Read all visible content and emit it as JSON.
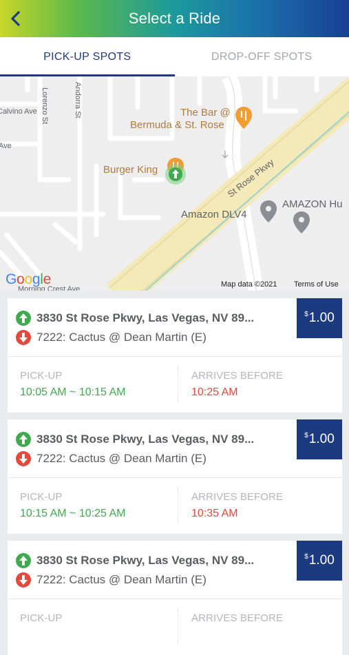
{
  "header": {
    "title": "Select a Ride",
    "back_icon": "chevron-left-icon"
  },
  "tabs": [
    {
      "label": "PICK-UP SPOTS",
      "active": true
    },
    {
      "label": "DROP-OFF SPOTS",
      "active": false
    }
  ],
  "map": {
    "streets": [
      "Calvino Ave",
      "Lorenzo St",
      "Andorra St",
      "Morning Crest Ave",
      "St Rose Pkwy",
      "Ave"
    ],
    "places": [
      "The Bar @",
      "Bermuda & St. Rose",
      "Burger King",
      "Amazon DLV4",
      "AMAZON Hu"
    ],
    "logo": "Google",
    "attribution": "Map data ©2021",
    "terms": "Terms of Use"
  },
  "rides": [
    {
      "pickup": "3830 St Rose Pkwy, Las Vegas, NV 89...",
      "dropoff": "7222: Cactus @ Dean Martin (E)",
      "currency": "$",
      "price": "1.00",
      "pickup_label": "PICK-UP",
      "pickup_time": "10:05 AM ~ 10:15 AM",
      "arrives_label": "ARRIVES BEFORE",
      "arrives_time": "10:25 AM"
    },
    {
      "pickup": "3830 St Rose Pkwy, Las Vegas, NV 89...",
      "dropoff": "7222: Cactus @ Dean Martin (E)",
      "currency": "$",
      "price": "1.00",
      "pickup_label": "PICK-UP",
      "pickup_time": "10:15 AM ~ 10:25 AM",
      "arrives_label": "ARRIVES BEFORE",
      "arrives_time": "10:35 AM"
    },
    {
      "pickup": "3830 St Rose Pkwy, Las Vegas, NV 89...",
      "dropoff": "7222: Cactus @ Dean Martin (E)",
      "currency": "$",
      "price": "1.00",
      "pickup_label": "PICK-UP",
      "pickup_time": "",
      "arrives_label": "ARRIVES BEFORE",
      "arrives_time": ""
    }
  ],
  "colors": {
    "brand_navy": "#1c3a80",
    "pickup_green": "#3faa4f",
    "dropoff_red": "#e4493b",
    "map_road": "#f4e9b8"
  }
}
